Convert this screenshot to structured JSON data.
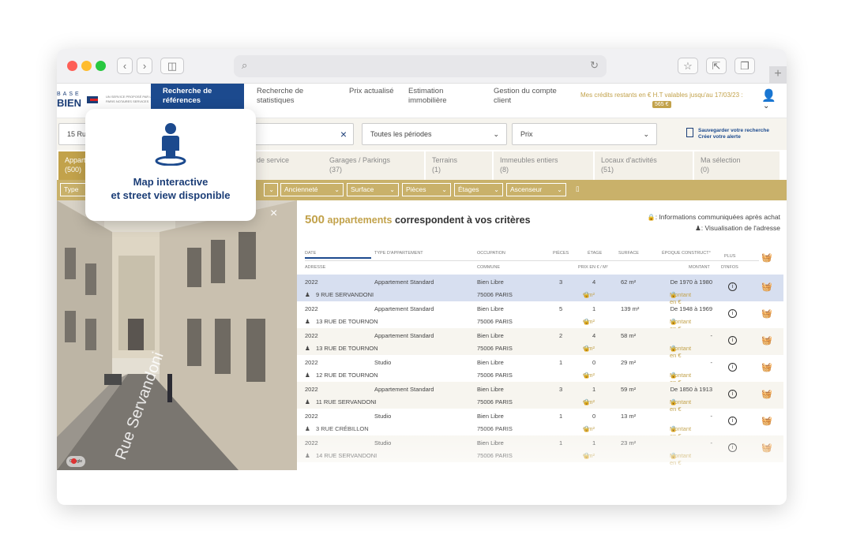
{
  "nav": {
    "logo_top": "BASE",
    "logo_bottom": "BIEN",
    "logo_sub": "UN SERVICE PROPOSÉ PAR LES PARIS NOTAIRES SERVICES",
    "items": [
      {
        "label": "Recherche de références",
        "active": true
      },
      {
        "label": "Recherche de statistiques"
      },
      {
        "label": "Prix actualisé"
      },
      {
        "label": "Estimation immobilière"
      },
      {
        "label": "Gestion du compte client"
      }
    ],
    "credits_text": "Mes crédits restants en € H.T valables jusqu'au 17/03/23 :",
    "credits_value": "565 €"
  },
  "search": {
    "value": "15 Ru",
    "period": "Toutes les périodes",
    "price": "Prix",
    "save_line1": "Sauvegarder votre recherche",
    "save_line2": "Créer votre alerte"
  },
  "categories": [
    {
      "label": "Apparte",
      "count": "(500)",
      "active": true
    },
    {
      "label": "de service",
      "count": ""
    },
    {
      "label": "Garages / Parkings",
      "count": "(37)"
    },
    {
      "label": "Terrains",
      "count": "(1)"
    },
    {
      "label": "Immeubles entiers",
      "count": "(8)"
    },
    {
      "label": "Locaux d'activités",
      "count": "(51)"
    },
    {
      "label": "Ma sélection",
      "count": "(0)"
    }
  ],
  "filters": [
    "Type",
    "Ancienneté",
    "Surface",
    "Pièces",
    "Étages",
    "Ascenseur"
  ],
  "street_view": {
    "street_name": "Rue Servandoni",
    "pegman_label": "Google"
  },
  "overlay": {
    "line1": "Map interactive",
    "line2": "et street view disponible"
  },
  "results": {
    "count": "500",
    "kind": "appartements",
    "suffix": "correspondent à vos critères",
    "legend_lock": ": Informations communiquées après achat",
    "legend_street": ": Visualisation de l'adresse",
    "headers_top": [
      "DATE",
      "TYPE D'APPARTEMENT",
      "OCCUPATION",
      "PIÈCES",
      "ÉTAGE",
      "SURFACE",
      "ÉPOQUE CONSTRUCT°",
      "PLUS"
    ],
    "headers_bottom": [
      "ADRESSE",
      "COMMUNE",
      "PRIX EN € / M²",
      "MONTANT",
      "D'INFOS"
    ],
    "locked_price": "€/m²",
    "locked_amount": "Montant en €",
    "rows": [
      {
        "year": "2022",
        "type": "Appartement Standard",
        "occupation": "Bien Libre",
        "rooms": "3",
        "floor": "4",
        "surface": "62 m²",
        "epoch": "De 1970 à 1980",
        "address": "9 RUE SERVANDONI",
        "commune": "75006 PARIS"
      },
      {
        "year": "2022",
        "type": "Appartement Standard",
        "occupation": "Bien Libre",
        "rooms": "5",
        "floor": "1",
        "surface": "139 m²",
        "epoch": "De 1948 à 1969",
        "address": "13 RUE DE TOURNON",
        "commune": "75006 PARIS"
      },
      {
        "year": "2022",
        "type": "Appartement Standard",
        "occupation": "Bien Libre",
        "rooms": "2",
        "floor": "4",
        "surface": "58 m²",
        "epoch": "-",
        "address": "13 RUE DE TOURNON",
        "commune": "75006 PARIS"
      },
      {
        "year": "2022",
        "type": "Studio",
        "occupation": "Bien Libre",
        "rooms": "1",
        "floor": "0",
        "surface": "29 m²",
        "epoch": "-",
        "address": "12 RUE DE TOURNON",
        "commune": "75006 PARIS"
      },
      {
        "year": "2022",
        "type": "Appartement Standard",
        "occupation": "Bien Libre",
        "rooms": "3",
        "floor": "1",
        "surface": "59 m²",
        "epoch": "De 1850 à 1913",
        "address": "11 RUE SERVANDONI",
        "commune": "75006 PARIS"
      },
      {
        "year": "2022",
        "type": "Studio",
        "occupation": "Bien Libre",
        "rooms": "1",
        "floor": "0",
        "surface": "13 m²",
        "epoch": "-",
        "address": "3 RUE CRÉBILLON",
        "commune": "75006 PARIS"
      },
      {
        "year": "2022",
        "type": "Studio",
        "occupation": "Bien Libre",
        "rooms": "1",
        "floor": "1",
        "surface": "23 m²",
        "epoch": "-",
        "address": "14 RUE SERVANDONI",
        "commune": "75006 PARIS"
      }
    ]
  }
}
